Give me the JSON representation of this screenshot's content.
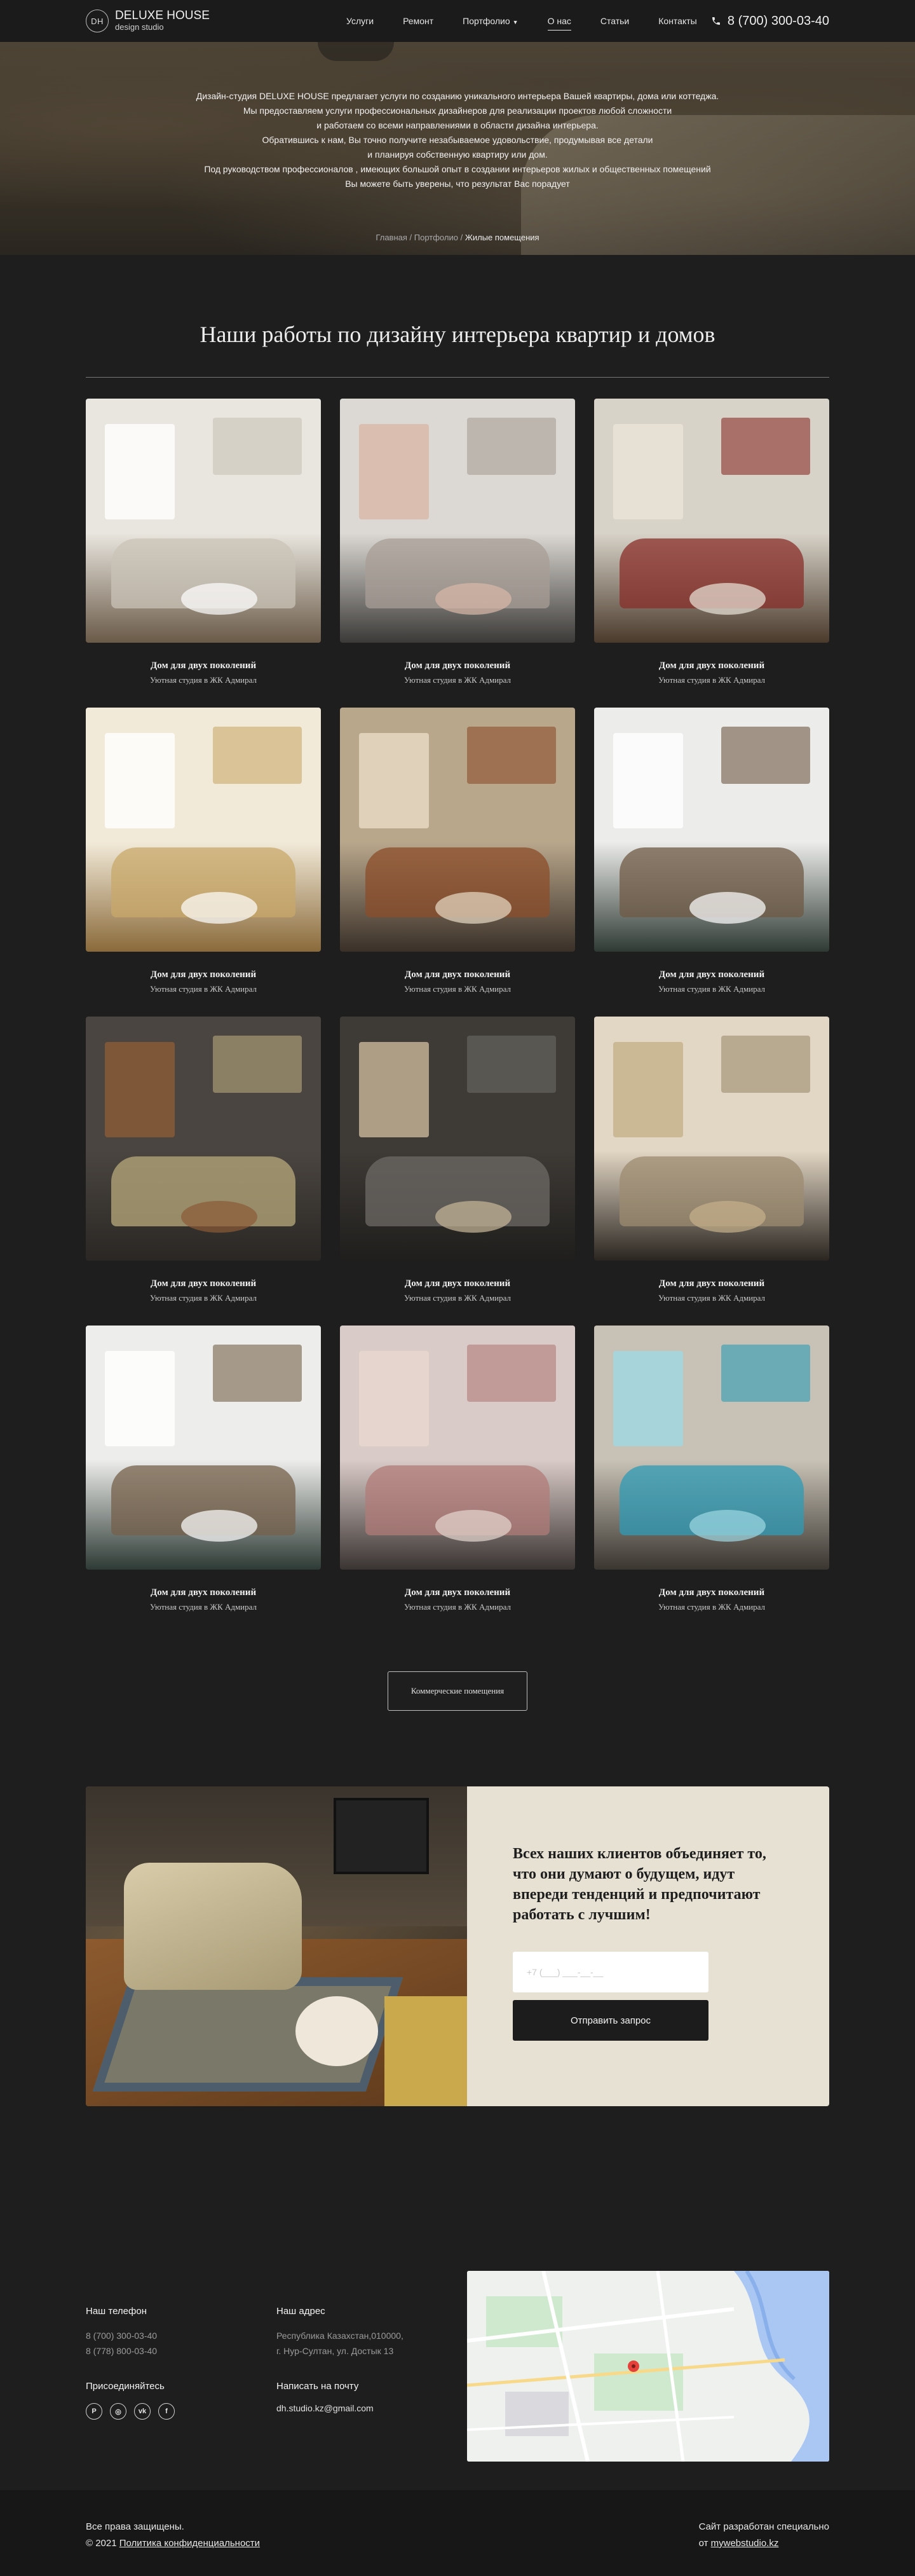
{
  "header": {
    "logo_mark": "DH",
    "logo_title": "DELUXE HOUSE",
    "logo_subtitle": "design studio",
    "nav": [
      {
        "label": "Услуги"
      },
      {
        "label": "Ремонт"
      },
      {
        "label": "Портфолио"
      },
      {
        "label": "О нас"
      },
      {
        "label": "Статьи"
      },
      {
        "label": "Контакты"
      }
    ],
    "active_nav": "О нас",
    "phone": "8 (700) 300-03-40"
  },
  "hero": {
    "lines": [
      "Дизайн-студия DELUXE HOUSE предлагает услуги по созданию уникального интерьера Вашей квартиры, дома или коттеджа.",
      "Мы предоставляем услуги профессиональных дизайнеров для реализации проектов любой сложности",
      "и работаем со всеми направлениями в области дизайна интерьера.",
      "Обратившись к нам, Вы точно получите незабываемое удовольствие, продумывая все детали",
      "и планируя собственную квартиру или дом.",
      "Под руководством профессионалов , имеющих большой опыт в создании интерьеров жилых и общественных помещений",
      "Вы можете быть уверены, что результат Вас порадует"
    ],
    "breadcrumbs": [
      "Главная",
      "Портфолио",
      "Жилые помещения"
    ]
  },
  "works": {
    "title": "Наши работы по дизайну интерьера квартир и домов",
    "items": [
      {
        "title": "Дом для двух поколений",
        "subtitle": "Уютная студия в ЖК Адмирал",
        "theme": "living-room-white"
      },
      {
        "title": "Дом для двух поколений",
        "subtitle": "Уютная студия в ЖК Адмирал",
        "theme": "bedroom-grey"
      },
      {
        "title": "Дом для двух поколений",
        "subtitle": "Уютная студия в ЖК Адмирал",
        "theme": "dining-red"
      },
      {
        "title": "Дом для двух поколений",
        "subtitle": "Уютная студия в ЖК Адмирал",
        "theme": "dining-gold"
      },
      {
        "title": "Дом для двух поколений",
        "subtitle": "Уютная студия в ЖК Адмирал",
        "theme": "living-wood"
      },
      {
        "title": "Дом для двух поколений",
        "subtitle": "Уютная студия в ЖК Адмирал",
        "theme": "kitchen-white"
      },
      {
        "title": "Дом для двух поколений",
        "subtitle": "Уютная студия в ЖК Адмирал",
        "theme": "bedroom-olive"
      },
      {
        "title": "Дом для двух поколений",
        "subtitle": "Уютная студия в ЖК Адмирал",
        "theme": "dining-dark"
      },
      {
        "title": "Дом для двух поколений",
        "subtitle": "Уютная студия в ЖК Адмирал",
        "theme": "bedroom-lamp"
      },
      {
        "title": "Дом для двух поколений",
        "subtitle": "Уютная студия в ЖК Адмирал",
        "theme": "kitchen-white-2"
      },
      {
        "title": "Дом для двух поколений",
        "subtitle": "Уютная студия в ЖК Адмирал",
        "theme": "office-pink"
      },
      {
        "title": "Дом для двух поколений",
        "subtitle": "Уютная студия в ЖК Адмирал",
        "theme": "pool"
      }
    ],
    "more_button": "Коммерческие помещения"
  },
  "cta": {
    "heading": "Всех наших клиентов объединяет то, что они думают о будущем, идут впереди тенденций и предпочитают работать с лучшим!",
    "input_placeholder": "+7 (___) ___-__-__",
    "submit_label": "Отправить запрос"
  },
  "footer": {
    "phone_heading": "Наш телефон",
    "phones": [
      "8 (700) 300-03-40",
      "8 (778) 800-03-40"
    ],
    "address_heading": "Наш адрес",
    "address_lines": [
      "Республика Казахстан,010000,",
      "г. Нур-Султан, ул. Достык 13"
    ],
    "social_heading": "Присоединяйтесь",
    "socials": [
      {
        "icon": "pinterest-icon",
        "glyph": "P"
      },
      {
        "icon": "instagram-icon",
        "glyph": "◎"
      },
      {
        "icon": "vk-icon",
        "glyph": "vk"
      },
      {
        "icon": "facebook-icon",
        "glyph": "f"
      }
    ],
    "mail_heading": "Написать на почту",
    "email": "dh.studio.kz@gmail.com"
  },
  "bottom": {
    "rights": "Все права защищены.",
    "copyright": "© 2021",
    "privacy_link": "Политика конфиденциальности",
    "credit_line": "Сайт разработан специально",
    "credit_prefix": "от",
    "credit_link": "mywebstudio.kz"
  },
  "colors": {
    "background": "#1e1e1e",
    "cta_panel": "#e6e1d3",
    "button_dark": "#1c1c1c"
  }
}
